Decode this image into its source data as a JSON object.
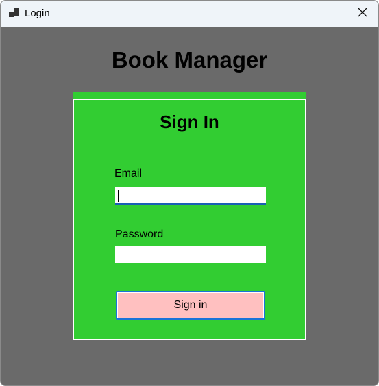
{
  "window": {
    "title": "Login",
    "icon": "app-windows-icon",
    "close_icon": "close-icon"
  },
  "main": {
    "heading": "Book Manager"
  },
  "form": {
    "title": "Sign In",
    "email_label": "Email",
    "email_value": "",
    "password_label": "Password",
    "password_value": "",
    "submit_label": "Sign in"
  },
  "colors": {
    "background": "#6a6a6a",
    "panel": "#32cd32",
    "button": "#ffc0c0",
    "button_border": "#1a73d8",
    "titlebar": "#eff4f9"
  }
}
